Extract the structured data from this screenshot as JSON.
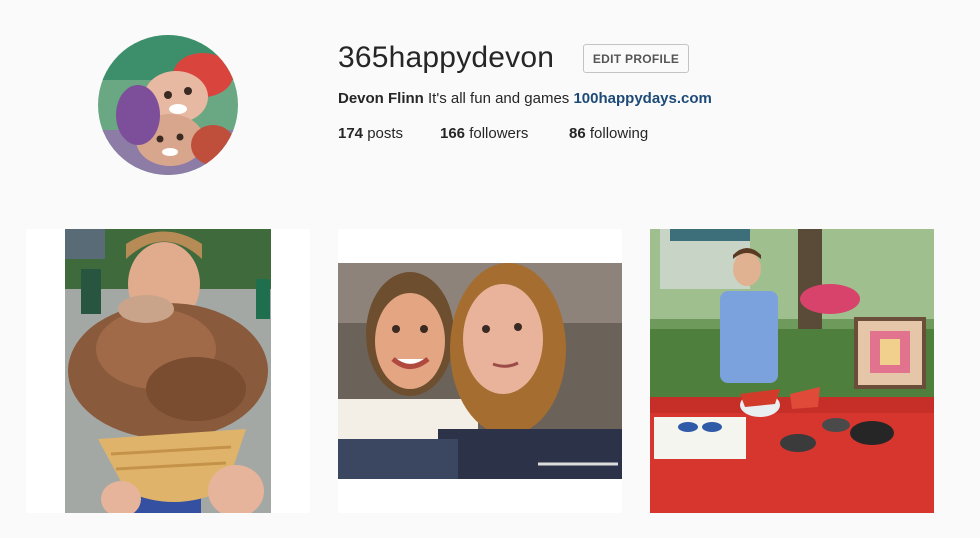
{
  "profile": {
    "username": "365happydevon",
    "edit_button": "EDIT PROFILE",
    "full_name": "Devon Flinn",
    "bio": "It's all fun and games",
    "website": "100happydays.com"
  },
  "stats": {
    "posts_count": "174",
    "posts_label": "posts",
    "followers_count": "166",
    "followers_label": "followers",
    "following_count": "86",
    "following_label": "following"
  },
  "photos": [
    {
      "subject": "ice-cream-cone"
    },
    {
      "subject": "two-friends-selfie"
    },
    {
      "subject": "party-table"
    }
  ]
}
